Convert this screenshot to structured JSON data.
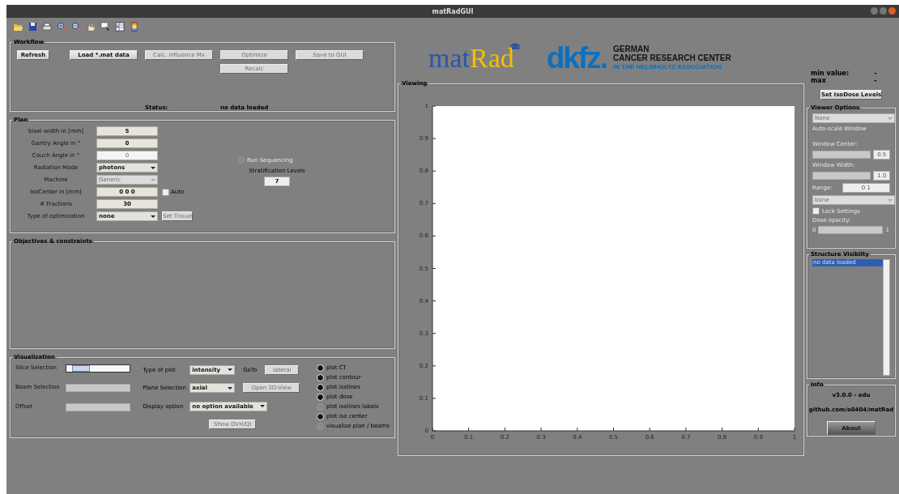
{
  "window": {
    "title": "matRadGUI"
  },
  "toolbar": [
    {
      "kind": "folder"
    },
    {
      "kind": "save"
    },
    {
      "kind": "print"
    },
    {
      "kind": "zoom-in"
    },
    {
      "kind": "zoom-out"
    },
    {
      "kind": "hand"
    },
    {
      "kind": "pointer"
    },
    {
      "kind": "table"
    },
    {
      "kind": "colorbar"
    }
  ],
  "workflow": {
    "title": "Workflow",
    "buttons": [
      {
        "label": "Refresh",
        "disabled": false
      },
      {
        "label": "Load  *.mat data",
        "disabled": false
      },
      {
        "label": "Calc. influence Mx",
        "disabled": true
      },
      {
        "label": "Optimize",
        "disabled": true
      },
      {
        "label": "Save to GUI",
        "disabled": true
      },
      {
        "label": "Recalc",
        "disabled": true
      }
    ],
    "status_label": "Status:",
    "status": "no data loaded"
  },
  "plan": {
    "title": "Plan",
    "fields": [
      {
        "label": "bixel width in [mm]",
        "kind": "input",
        "value": "5",
        "disabled": false
      },
      {
        "label": "Gantry Angle in °",
        "kind": "input",
        "value": "0",
        "disabled": false
      },
      {
        "label": "Couch Angle in °",
        "kind": "input",
        "value": "0",
        "disabled": true
      },
      {
        "label": "Radiation Mode",
        "kind": "dropdown",
        "value": "photons",
        "disabled": false
      },
      {
        "label": "Machine",
        "kind": "dropdown",
        "value": "Generic",
        "disabled": true
      },
      {
        "label": "IsoCenter in [mm]",
        "kind": "input",
        "value": "0 0 0",
        "disabled": false
      },
      {
        "label": "# Fractions",
        "kind": "input",
        "value": "30",
        "disabled": false
      },
      {
        "label": "Type of optimization",
        "kind": "dropdown",
        "value": "none",
        "disabled": false
      }
    ],
    "auto": {
      "label": "Auto",
      "checked": false
    },
    "set_tissue": {
      "label": "Set Tissue",
      "disabled": true
    },
    "run_sequencing": {
      "label": "Run Sequencing",
      "checked": false,
      "disabled": true
    },
    "stratification": {
      "label": "Stratification Levels",
      "value": "7"
    }
  },
  "objectives": {
    "title": "Objectives & constraints"
  },
  "visualization": {
    "title": "Visualization",
    "sliders": [
      {
        "label": "Slice Selection",
        "level": 0.12,
        "disabled": false
      },
      {
        "label": "Beam Selection",
        "disabled": true
      },
      {
        "label": "Offset",
        "disabled": true
      }
    ],
    "type_of_plot": {
      "label": "Type of plot",
      "value": "intensity"
    },
    "goto": {
      "label": "GoTo",
      "button": "lateral"
    },
    "plane": {
      "label": "Plane Selection",
      "value": "axial"
    },
    "open_3d": "Open 3D-View",
    "display": {
      "label": "Display option",
      "value": "no option available"
    },
    "show_dvh": "Show DVH/QI",
    "options": [
      {
        "label": "plot CT",
        "checked": true
      },
      {
        "label": "plot contour",
        "checked": true
      },
      {
        "label": "plot isolines",
        "checked": true
      },
      {
        "label": "plot dose",
        "checked": true
      },
      {
        "label": "plot isolines labels",
        "checked": false
      },
      {
        "label": "plot iso center",
        "checked": true
      },
      {
        "label": "visualize plan / beams",
        "checked": false
      }
    ]
  },
  "logos": {
    "matrad": [
      "mat",
      "Rad"
    ],
    "dkfz": "dkfz.",
    "dkfz_lines": [
      "GERMAN",
      "CANCER RESEARCH CENTER",
      "IN THE HELMHOLTZ ASSOCIATION"
    ]
  },
  "viewing": {
    "title": "Viewing",
    "chart_data": {
      "type": "line",
      "xlim": [
        0,
        1
      ],
      "ylim": [
        0,
        1
      ],
      "xticks": [
        0,
        0.1,
        0.2,
        0.3,
        0.4,
        0.5,
        0.6,
        0.7,
        0.8,
        0.9,
        1
      ],
      "yticks": [
        0,
        0.1,
        0.2,
        0.3,
        0.4,
        0.5,
        0.6,
        0.7,
        0.8,
        0.9,
        1
      ]
    }
  },
  "values": [
    {
      "label": "min value:",
      "value": "-"
    },
    {
      "label": "max",
      "value": "-"
    }
  ],
  "set_isodose": "Set IsoDose Levels",
  "viewer_options": {
    "title": "Viewer Options",
    "items": [
      {
        "kind": "dropdown",
        "value": "None"
      },
      {
        "kind": "label",
        "label": "Auto-scale Window"
      },
      {
        "kind": "slider-field",
        "label": "Window Center:",
        "value": "0.5"
      },
      {
        "kind": "slider-field",
        "label": "Window Width:",
        "value": "1.0"
      },
      {
        "kind": "range",
        "label": "Range:",
        "value": "0 1"
      },
      {
        "kind": "dropdown",
        "value": "bone"
      },
      {
        "kind": "checkbox",
        "label": "Lock Settings",
        "checked": false
      },
      {
        "kind": "slider-range",
        "label": "Dose opacity:",
        "min": "0",
        "max": "1"
      }
    ]
  },
  "structures": {
    "title": "Structure Visibilty",
    "items": [
      {
        "label": "no data loaded",
        "selected": true
      }
    ]
  },
  "info": {
    "title": "Info",
    "version": "v3.0.0 - edu",
    "link": "github.com/e0404/matRad",
    "about": "About"
  }
}
